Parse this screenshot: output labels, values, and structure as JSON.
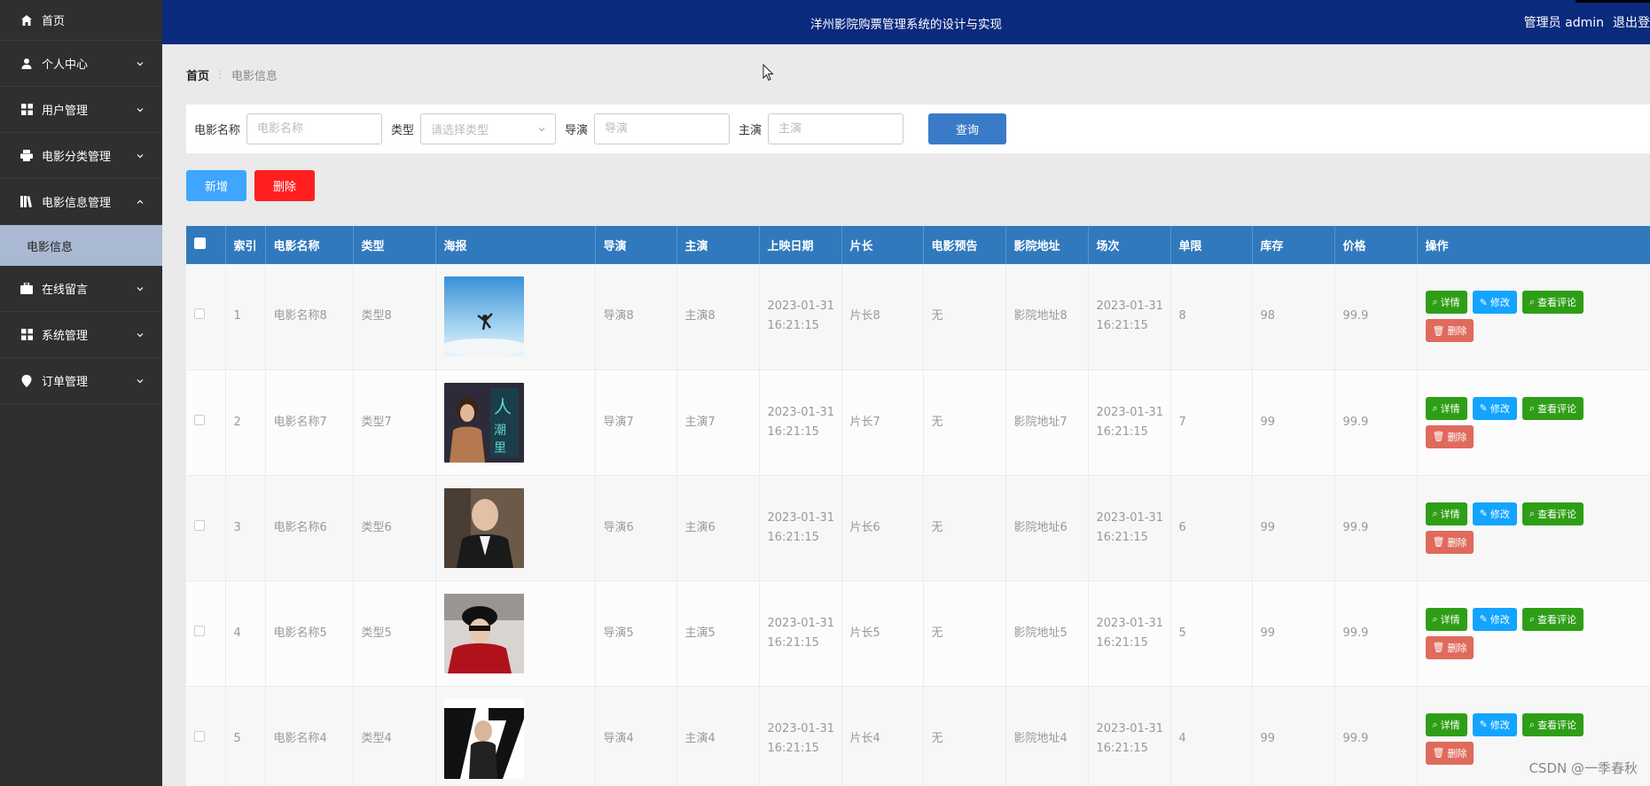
{
  "sidebar": {
    "items": [
      {
        "label": "首页",
        "icon": "home-icon",
        "chevron": false
      },
      {
        "label": "个人中心",
        "icon": "user-icon",
        "chevron": true
      },
      {
        "label": "用户管理",
        "icon": "grid-icon",
        "chevron": true
      },
      {
        "label": "电影分类管理",
        "icon": "printer-icon",
        "chevron": true
      },
      {
        "label": "电影信息管理",
        "icon": "library-icon",
        "chevron": true,
        "expanded": true
      },
      {
        "label": "在线留言",
        "icon": "briefcase-icon",
        "chevron": true
      },
      {
        "label": "系统管理",
        "icon": "grid-icon",
        "chevron": true
      },
      {
        "label": "订单管理",
        "icon": "location-icon",
        "chevron": true
      }
    ],
    "subitem": "电影信息"
  },
  "header": {
    "title": "洋州影院购票管理系统的设计与实现",
    "user": "管理员 admin",
    "logout": "退出登"
  },
  "breadcrumb": {
    "home": "首页",
    "current": "电影信息"
  },
  "search": {
    "name_label": "电影名称",
    "name_placeholder": "电影名称",
    "type_label": "类型",
    "type_placeholder": "请选择类型",
    "director_label": "导演",
    "director_placeholder": "导演",
    "actor_label": "主演",
    "actor_placeholder": "主演",
    "query_label": "查询"
  },
  "actions": {
    "add_label": "新增",
    "delete_label": "删除"
  },
  "table": {
    "headers": [
      "",
      "索引",
      "电影名称",
      "类型",
      "海报",
      "导演",
      "主演",
      "上映日期",
      "片长",
      "电影预告",
      "影院地址",
      "场次",
      "单限",
      "库存",
      "价格",
      "操作"
    ],
    "op_labels": {
      "detail": "详情",
      "edit": "修改",
      "review": "查看评论",
      "delete": "删除"
    },
    "rows": [
      {
        "index": "1",
        "name": "电影名称8",
        "type": "类型8",
        "director": "导演8",
        "actor": "主演8",
        "date1": "2023-01-31",
        "time1": "16:21:15",
        "length": "片长8",
        "trailer": "无",
        "address": "影院地址8",
        "date2": "2023-01-31",
        "time2": "16:21:15",
        "limit": "8",
        "stock": "98",
        "price": "99.9"
      },
      {
        "index": "2",
        "name": "电影名称7",
        "type": "类型7",
        "director": "导演7",
        "actor": "主演7",
        "date1": "2023-01-31",
        "time1": "16:21:15",
        "length": "片长7",
        "trailer": "无",
        "address": "影院地址7",
        "date2": "2023-01-31",
        "time2": "16:21:15",
        "limit": "7",
        "stock": "99",
        "price": "99.9"
      },
      {
        "index": "3",
        "name": "电影名称6",
        "type": "类型6",
        "director": "导演6",
        "actor": "主演6",
        "date1": "2023-01-31",
        "time1": "16:21:15",
        "length": "片长6",
        "trailer": "无",
        "address": "影院地址6",
        "date2": "2023-01-31",
        "time2": "16:21:15",
        "limit": "6",
        "stock": "99",
        "price": "99.9"
      },
      {
        "index": "4",
        "name": "电影名称5",
        "type": "类型5",
        "director": "导演5",
        "actor": "主演5",
        "date1": "2023-01-31",
        "time1": "16:21:15",
        "length": "片长5",
        "trailer": "无",
        "address": "影院地址5",
        "date2": "2023-01-31",
        "time2": "16:21:15",
        "limit": "5",
        "stock": "99",
        "price": "99.9"
      },
      {
        "index": "5",
        "name": "电影名称4",
        "type": "类型4",
        "director": "导演4",
        "actor": "主演4",
        "date1": "2023-01-31",
        "time1": "16:21:15",
        "length": "片长4",
        "trailer": "无",
        "address": "影院地址4",
        "date2": "2023-01-31",
        "time2": "16:21:15",
        "limit": "4",
        "stock": "99",
        "price": "99.9"
      }
    ]
  },
  "watermark": "CSDN @一季春秋",
  "colors": {
    "header_bg": "#0a2a7d",
    "sidebar_bg": "#2f2f2f",
    "table_head": "#3079bd",
    "add_btn": "#3ea6ff",
    "delete_btn": "#ff1f1f",
    "detail_btn": "#2f9e17",
    "edit_btn": "#12a4ff",
    "row_delete_btn": "#e06a5b"
  }
}
